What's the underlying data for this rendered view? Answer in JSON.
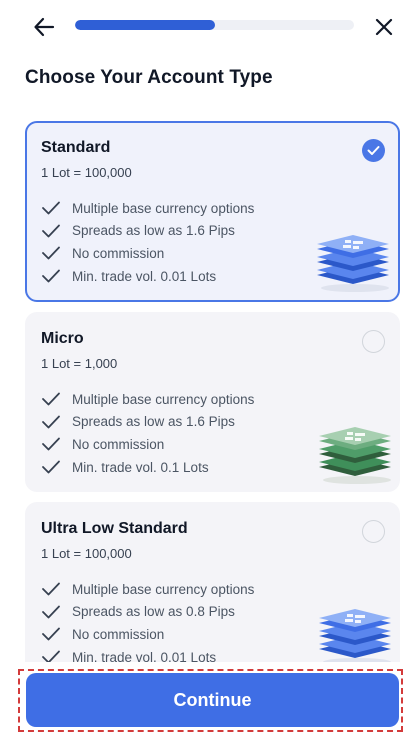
{
  "header": {
    "back_icon": "arrow-left-icon",
    "close_icon": "close-icon",
    "progress_fraction": 0.5
  },
  "page_title": "Choose Your Account Type",
  "accounts": [
    {
      "name": "Standard",
      "lot": "1 Lot = 100,000",
      "selected": true,
      "accent": "#4a77e6",
      "illustration": "blue-layer-stack-icon",
      "features": [
        "Multiple base currency options",
        "Spreads as low as 1.6 Pips",
        "No commission",
        "Min. trade vol. 0.01 Lots"
      ]
    },
    {
      "name": "Micro",
      "lot": "1 Lot = 1,000",
      "selected": false,
      "accent": "#3f8f5a",
      "illustration": "green-layer-stack-icon",
      "features": [
        "Multiple base currency options",
        "Spreads as low as 1.6 Pips",
        "No commission",
        "Min. trade vol. 0.1 Lots"
      ]
    },
    {
      "name": "Ultra Low Standard",
      "lot": "1 Lot = 100,000",
      "selected": false,
      "accent": "#4a77e6",
      "illustration": "blue-layer-stack-icon",
      "features": [
        "Multiple base currency options",
        "Spreads as low as 0.8 Pips",
        "No commission",
        "Min. trade vol. 0.01 Lots"
      ]
    }
  ],
  "continue_label": "Continue",
  "colors": {
    "primary": "#3f6ee5",
    "highlight_box": "#d33b3b"
  }
}
